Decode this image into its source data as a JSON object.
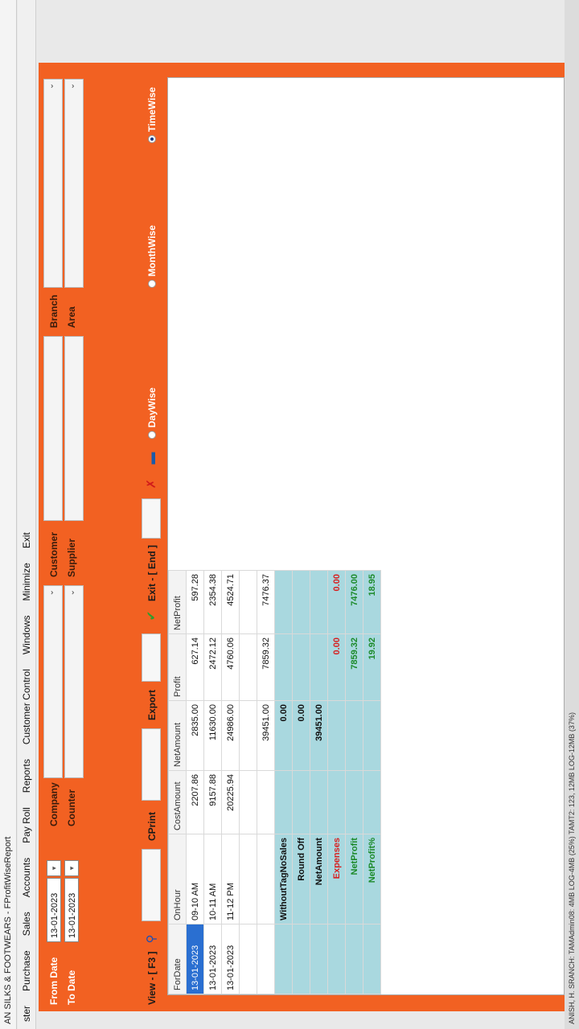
{
  "window": {
    "title": "AN SILKS & FOOTWEARS - FProfitWiseReport"
  },
  "menu": [
    "ster",
    "Purchase",
    "Sales",
    "Accounts",
    "Pay Roll",
    "Reports",
    "Customer Control",
    "Windows",
    "Minimize",
    "Exit"
  ],
  "filters": {
    "from_date_label": "From Date",
    "to_date_label": "To Date",
    "from_date": "13-01-2023",
    "to_date": "13-01-2023",
    "company_label": "Company",
    "counter_label": "Counter",
    "customer_label": "Customer",
    "supplier_label": "Supplier",
    "branch_label": "Branch",
    "area_label": "Area"
  },
  "toolbar": {
    "view_label": "View - [ F3 ]",
    "cprint_label": "CPrint",
    "export_label": "Export",
    "exit_label": "Exit - [ End ]",
    "daywise_label": "DayWise",
    "monthwise_label": "MonthWise",
    "timewise_label": "TimeWise",
    "selected_mode": "TimeWise"
  },
  "grid": {
    "headers": [
      "ForDate",
      "OnHour",
      "CostAmount",
      "NetAmount",
      "Profit",
      "NetProfit"
    ],
    "rows": [
      [
        "13-01-2023",
        "09-10 AM",
        "2207.86",
        "2835.00",
        "627.14",
        "597.28"
      ],
      [
        "13-01-2023",
        "10-11 AM",
        "9157.88",
        "11630.00",
        "2472.12",
        "2354.38"
      ],
      [
        "13-01-2023",
        "11-12 PM",
        "20225.94",
        "24986.00",
        "4760.06",
        "4524.71"
      ]
    ],
    "totals": {
      "net_amount": "39451.00",
      "profit": "7859.32",
      "net_profit": "7476.37"
    },
    "summary": [
      {
        "label": "WithoutTagNoSales",
        "value": "0.00",
        "value2": ""
      },
      {
        "label": "Round Off",
        "value": "0.00",
        "value2": ""
      },
      {
        "label": "NetAmount",
        "value": "39451.00",
        "value2": ""
      },
      {
        "label": "Expenses",
        "value": "0.00",
        "value2": "0.00"
      },
      {
        "label": "NetProfit",
        "value": "7859.32",
        "value2": "7476.00"
      },
      {
        "label": "NetProfit%",
        "value": "19.92",
        "value2": "18.95"
      }
    ]
  },
  "status": {
    "text": "ANISH, H. SRANCH: TAMAdmin08: 4MB LOG-4MB (25%) TAMT2: 123, 12MB LOG-12MB (37%)"
  },
  "colors": {
    "frame": "#f26122",
    "selected": "#2a6fd1",
    "summary_bg": "#a9d8df",
    "expenses": "#d72020",
    "netprofit": "#1c8a2a"
  }
}
